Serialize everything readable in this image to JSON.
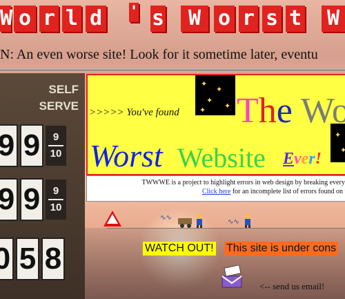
{
  "header": {
    "title_tiles": [
      "W",
      "o",
      "r",
      "l",
      "d",
      "'",
      "s",
      "W",
      "o",
      "r",
      "s",
      "t",
      "W"
    ],
    "announcement": "N: An even worse site! Look for it sometime later, eventu"
  },
  "sign": {
    "self_label": "SELF",
    "serve_label": "SERVE",
    "prices": [
      {
        "digits": [
          "9",
          "9"
        ],
        "frac_top": "9",
        "frac_bottom": "10"
      },
      {
        "digits": [
          "9",
          "9"
        ],
        "frac_top": "9",
        "frac_bottom": "10"
      },
      {
        "digits": [
          "0",
          "5",
          "8"
        ],
        "frac_top": "",
        "frac_bottom": ""
      }
    ]
  },
  "banner": {
    "found_text": ">>>>> You've found",
    "the_t": "T",
    "the_h": "h",
    "the_e": "e",
    "wor": "Wor",
    "worst": "Worst",
    "website": "Website",
    "ever_e": "E",
    "ever_v": "v",
    "ever_e2": "e",
    "ever_r": "r",
    "ever_bang": "!"
  },
  "info": {
    "line1": "TWWWE is a project to highlight errors in web design by breaking every sin",
    "link_text": "Click here",
    "line2_rest": " for an incomplete list of errors found on this"
  },
  "notices": {
    "watch_out": "WATCH OUT!",
    "under_construction": "This site is under cons"
  },
  "contact": {
    "send_email": "<-- send us email!"
  },
  "colors": {
    "tile_red": "#e0231f",
    "banner_yellow": "#ffff44",
    "worst_blue": "#1322e6",
    "website_green": "#39d24a",
    "link_blue": "#1a3ce0"
  }
}
